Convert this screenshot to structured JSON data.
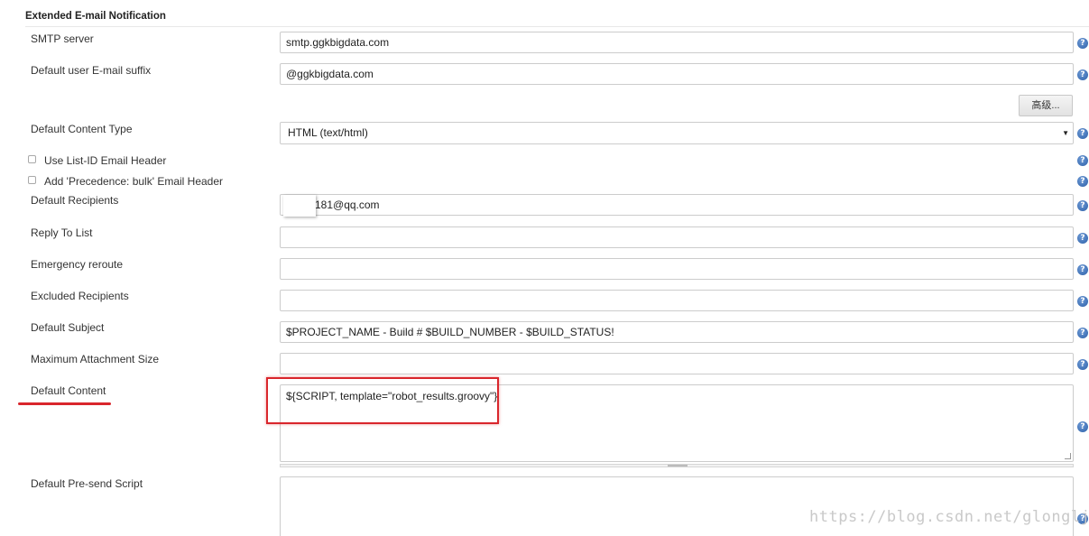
{
  "section": {
    "title": "Extended E-mail Notification"
  },
  "smtp_server": {
    "label": "SMTP server",
    "value": "smtp.ggkbigdata.com"
  },
  "default_suffix": {
    "label": "Default user E-mail suffix",
    "value": "@ggkbigdata.com"
  },
  "advanced_button": {
    "label": "高级..."
  },
  "content_type": {
    "label": "Default Content Type",
    "value": "HTML (text/html)",
    "arrow": "▼"
  },
  "checkboxes": {
    "list_id": {
      "label": "Use List-ID Email Header",
      "checked": false
    },
    "precedence": {
      "label": "Add 'Precedence: bulk' Email Header",
      "checked": false
    }
  },
  "default_recipients": {
    "label": "Default Recipients",
    "value": "181@qq.com"
  },
  "reply_to": {
    "label": "Reply To List",
    "value": ""
  },
  "emergency": {
    "label": "Emergency reroute",
    "value": ""
  },
  "excluded": {
    "label": "Excluded Recipients",
    "value": ""
  },
  "default_subject": {
    "label": "Default Subject",
    "value": "$PROJECT_NAME - Build # $BUILD_NUMBER - $BUILD_STATUS!"
  },
  "max_attachment": {
    "label": "Maximum Attachment Size",
    "value": ""
  },
  "default_content": {
    "label": "Default Content",
    "value": "${SCRIPT, template=\"robot_results.groovy\"}"
  },
  "presend_script": {
    "label": "Default Pre-send Script",
    "value": ""
  },
  "help_glyph": "?",
  "watermark": "https://blog.csdn.net/glonglj",
  "colors": {
    "highlight_red": "#d9262c",
    "help_blue": "#2b5fa8",
    "field_border": "#cccccc"
  }
}
